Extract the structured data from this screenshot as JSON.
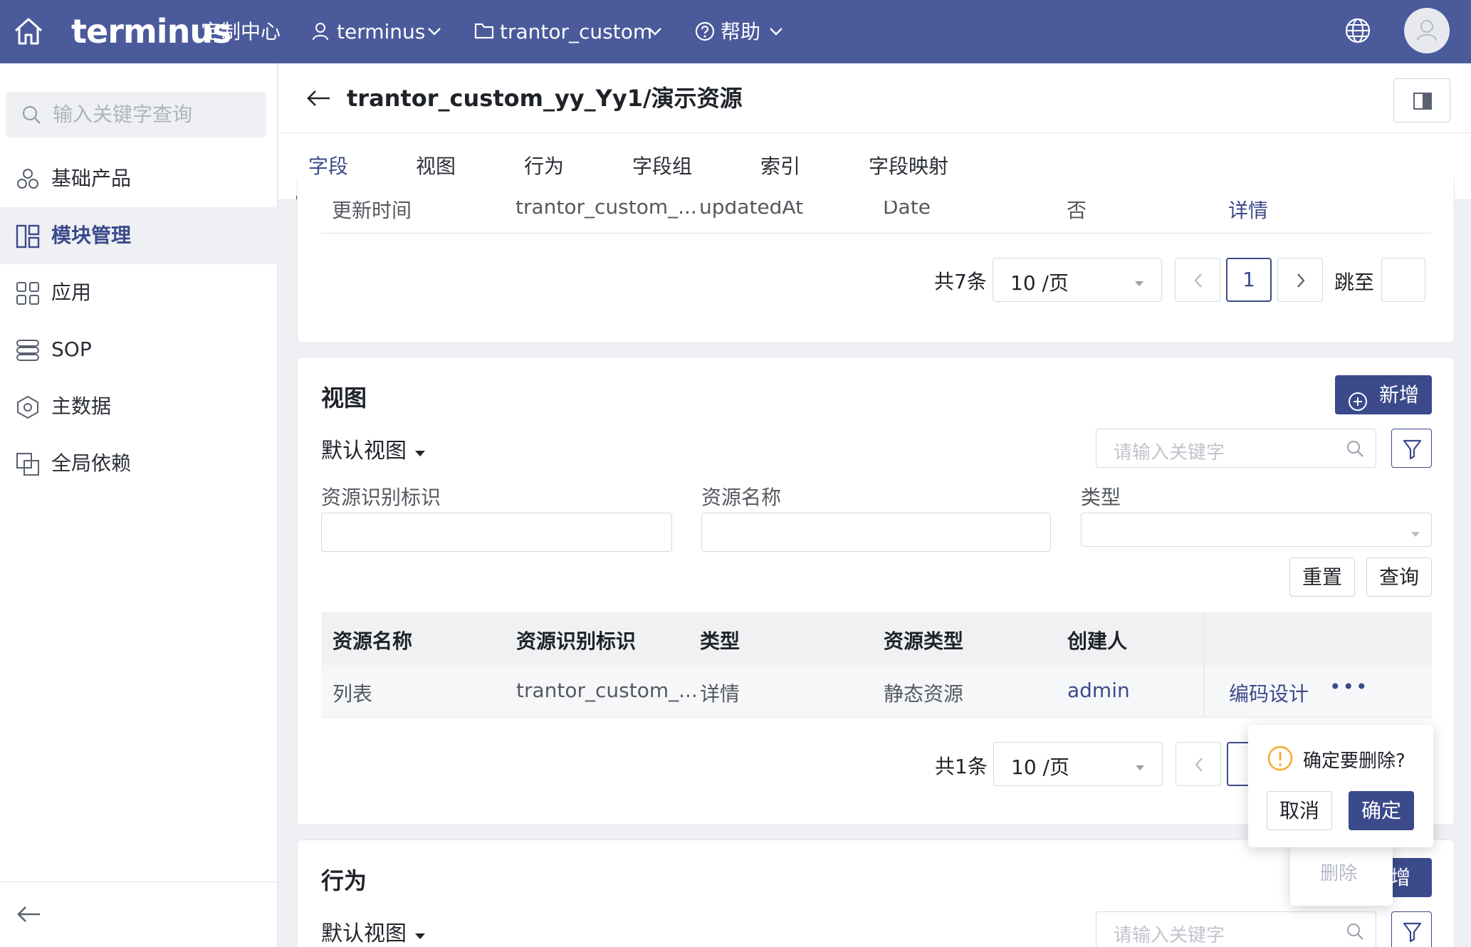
{
  "topbar": {
    "brand": "terminus",
    "brand_suffix": "定制中心",
    "user": "terminus",
    "project": "trantor_custom",
    "help": "帮助",
    "icons": [
      "home-icon",
      "user-icon",
      "folder-icon",
      "help-circle-icon",
      "globe-icon",
      "avatar"
    ]
  },
  "sidebar": {
    "search_placeholder": "输入关键字查询",
    "items": [
      {
        "label": "基础产品",
        "icon": "products-icon"
      },
      {
        "label": "模块管理",
        "icon": "module-icon",
        "active": true
      },
      {
        "label": "应用",
        "icon": "apps-icon"
      },
      {
        "label": "SOP",
        "icon": "sop-icon"
      },
      {
        "label": "主数据",
        "icon": "master-data-icon"
      },
      {
        "label": "全局依赖",
        "icon": "dependency-icon"
      }
    ]
  },
  "header": {
    "title": "trantor_custom_yy_Yy1/演示资源"
  },
  "tabs": [
    "字段",
    "视图",
    "行为",
    "字段组",
    "索引",
    "字段映射"
  ],
  "fields_section": {
    "last_row": [
      "更新时间",
      "trantor_custom_...",
      "updatedAt",
      "Date",
      "否",
      "详情"
    ],
    "pagination": {
      "total": "共7条",
      "page_size": "10 /页",
      "page": "1",
      "jump": "跳至"
    }
  },
  "views_section": {
    "title": "视图",
    "add_label": "新增",
    "default_view": "默认视图",
    "search_placeholder": "请输入关键字",
    "filters": {
      "label1": "资源识别标识",
      "label2": "资源名称",
      "label3": "类型"
    },
    "reset_label": "重置",
    "query_label": "查询",
    "columns": [
      "资源名称",
      "资源识别标识",
      "类型",
      "资源类型",
      "创建人"
    ],
    "rows": [
      {
        "name": "列表",
        "key": "trantor_custom_...",
        "type": "详情",
        "resource_type": "静态资源",
        "creator": "admin",
        "action": "编码设计",
        "more": "•••"
      }
    ],
    "pagination": {
      "total": "共1条",
      "page_size": "10 /页"
    }
  },
  "popconfirm": {
    "message": "确定要删除?",
    "cancel": "取消",
    "ok": "确定",
    "menu_item": "删除"
  },
  "behavior_section": {
    "title": "行为",
    "add_label": "增",
    "default_view": "默认视图",
    "search_placeholder": "请输入关键字"
  },
  "colors": {
    "primary": "#3b4a8b",
    "topbar": "#4b5a9b",
    "warning": "#f5a623"
  }
}
